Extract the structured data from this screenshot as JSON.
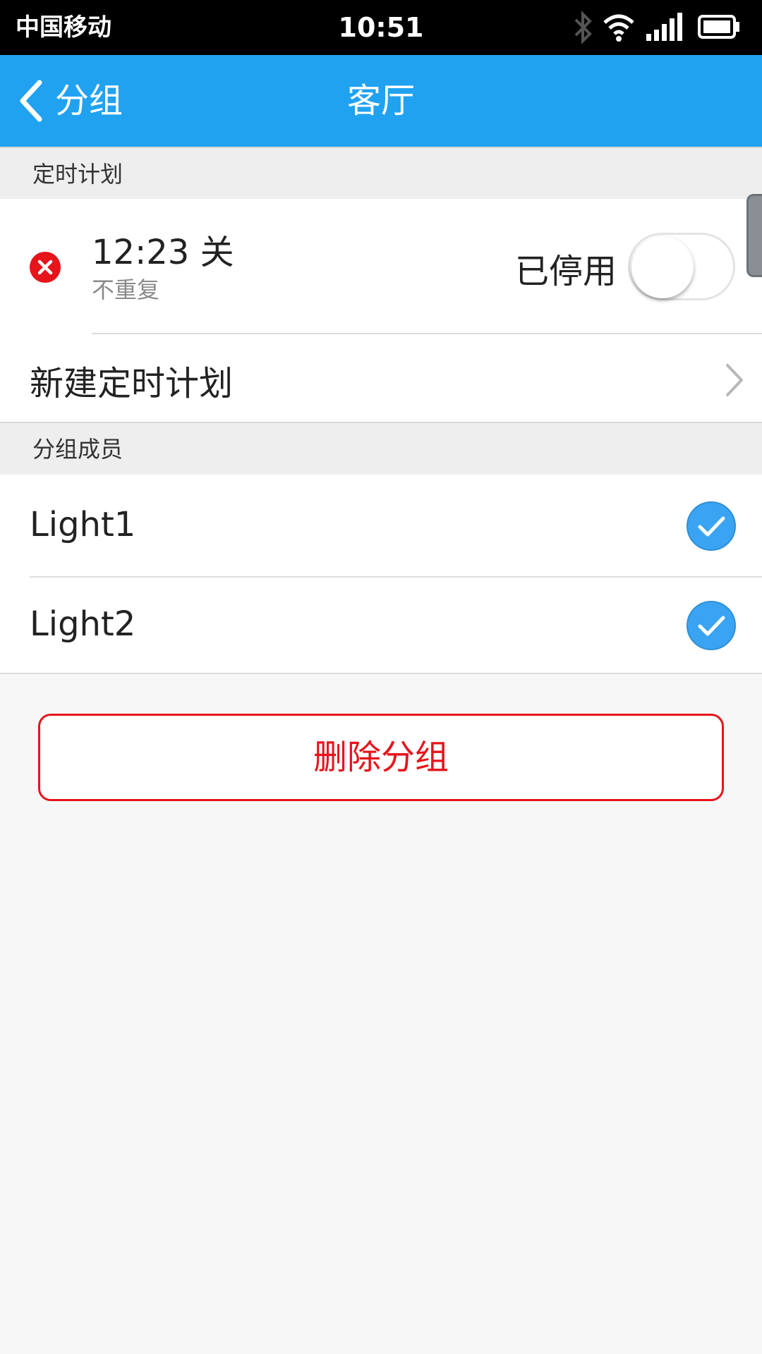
{
  "status_bar": {
    "carrier": "中国移动",
    "time": "10:51",
    "icons": [
      "bluetooth-icon",
      "wifi-icon",
      "signal-icon",
      "battery-icon"
    ]
  },
  "nav": {
    "back_label": "分组",
    "title": "客厅"
  },
  "schedule_section": {
    "header": "定时计划",
    "items": [
      {
        "time": "12:23 关",
        "repeat": "不重复",
        "status": "已停用",
        "enabled": false
      }
    ],
    "new_label": "新建定时计划"
  },
  "members_section": {
    "header": "分组成员",
    "members": [
      {
        "name": "Light1",
        "checked": true
      },
      {
        "name": "Light2",
        "checked": true
      }
    ]
  },
  "delete_button_label": "删除分组",
  "colors": {
    "nav_bar": "#21a2f1",
    "check": "#3aa4f3",
    "danger": "#e6141b"
  }
}
